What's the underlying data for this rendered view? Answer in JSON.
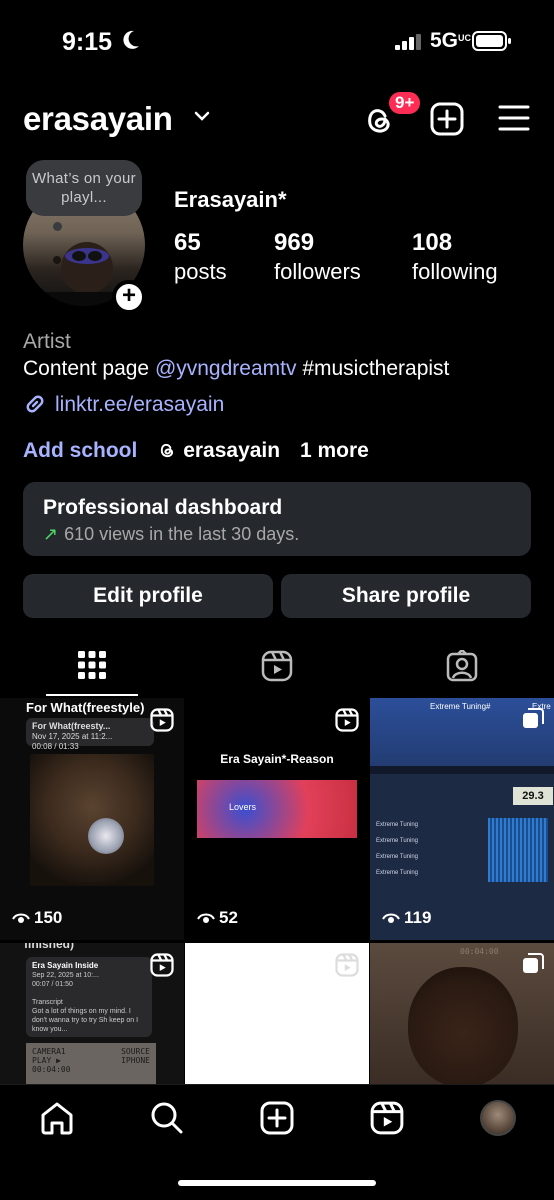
{
  "status_bar": {
    "time": "9:15",
    "network": "5G",
    "network_suffix": "UC"
  },
  "header": {
    "username": "erasayain",
    "notif_badge": "9+"
  },
  "profile": {
    "note": "What’s on your playl...",
    "display_name": "Erasayain*",
    "stats": [
      {
        "value": "65",
        "label": "posts"
      },
      {
        "value": "969",
        "label": "followers"
      },
      {
        "value": "108",
        "label": "following"
      }
    ],
    "category": "Artist",
    "bio_prefix": "Content page ",
    "bio_mention": "@yvngdreamtv",
    "bio_suffix": " #musictherapist",
    "link": "linktr.ee/erasayain",
    "add_school": "Add school",
    "threads_handle": "erasayain",
    "more": "1 more"
  },
  "dashboard": {
    "title": "Professional dashboard",
    "arrow": "↗",
    "subtitle": "610 views in the last 30 days."
  },
  "buttons": {
    "edit": "Edit profile",
    "share": "Share profile"
  },
  "grid": {
    "posts": [
      {
        "title": "For What(freestyle)",
        "card_title": "For What(freesty...",
        "card_date": "Nov 17, 2025 at 11:2...",
        "card_time": "00:08 / 01:33",
        "views": "150"
      },
      {
        "title": "Era Sayain*-Reason",
        "art_label": "Lovers",
        "views": "52"
      },
      {
        "banner": "Extreme Tuning#",
        "banner2": "Extre",
        "lcd": "29.3",
        "track_label": "Extreme Tuning",
        "views": "119"
      },
      {
        "header": "finished)",
        "card_title": "Era Sayain Inside",
        "card_date": "Sep 22, 2025 at 10:...",
        "card_time": "00:07 / 01:50",
        "transcript_label": "Transcript",
        "transcript": "Got a lot of things on my mind. I don't wanna try to try Sh keep on I know you...",
        "cam_left": "CAMERA1",
        "cam_left2": "PLAY ▶",
        "cam_left3": "00:04:00",
        "cam_right": "SOURCE",
        "cam_right2": "IPHONE"
      },
      {},
      {
        "time": "00:04:00"
      }
    ]
  }
}
